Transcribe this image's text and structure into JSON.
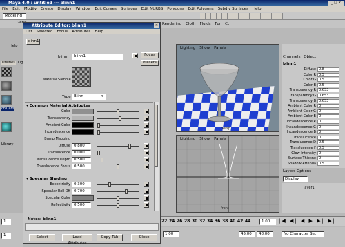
{
  "main_window": {
    "title": "Maya 4.0 : untitled  ---  blinn1",
    "menu": [
      "File",
      "Edit",
      "Modify",
      "Create",
      "Display",
      "Window",
      "Edit Curves",
      "Surfaces",
      "Edit NURBS",
      "Polygons",
      "Edit Polygons",
      "Subdiv Surfaces",
      "Help"
    ],
    "mode_dropdown": "Modeling",
    "shelf_tab": "Gene",
    "panel_menus": [
      "Rendering",
      "Cloth",
      "Fluids",
      "Fur",
      "Custom"
    ],
    "left_panel_labels": [
      "Help",
      "Utilities",
      "Lig",
      "Library"
    ],
    "node_label": "ch1lam"
  },
  "attribute_editor": {
    "title": "Attribute Editor: blinn1",
    "menu": [
      "List",
      "Selected",
      "Focus",
      "Attributes",
      "Help"
    ],
    "tab": "blinn1",
    "node_label": "blinn",
    "node_value": "blinn1",
    "focus_button": "Focus",
    "presets_button": "Presets",
    "sample_label": "Material Sample",
    "type_label": "Type",
    "type_value": "Blinn",
    "common_section": "Common Material Attributes",
    "common_rows": [
      {
        "label": "Color",
        "kind": "swatch",
        "value": "",
        "color": "#909090",
        "thumb": 0.5
      },
      {
        "label": "Transparency",
        "kind": "swatch",
        "value": "",
        "color": "#b4b4b4",
        "thumb": 0.55
      },
      {
        "label": "Ambient Color",
        "kind": "swatch",
        "value": "",
        "color": "#000000",
        "thumb": 0.02
      },
      {
        "label": "Incandescence",
        "kind": "swatch",
        "value": "",
        "color": "#000000",
        "thumb": 0.02
      },
      {
        "label": "Bump Mapping",
        "kind": "none",
        "value": "",
        "color": "",
        "thumb": 0
      },
      {
        "label": "Diffuse",
        "kind": "field",
        "value": "0.800",
        "color": "",
        "thumb": 0.8
      },
      {
        "label": "Translucence",
        "kind": "field",
        "value": "0.000",
        "color": "",
        "thumb": 0.02
      },
      {
        "label": "Translucence Depth",
        "kind": "field",
        "value": "0.500",
        "color": "",
        "thumb": 0.1
      },
      {
        "label": "Translucence Focus",
        "kind": "field",
        "value": "0.500",
        "color": "",
        "thumb": 0.5
      }
    ],
    "specular_section": "Specular Shading",
    "specular_rows": [
      {
        "label": "Eccentricity",
        "kind": "field",
        "value": "0.300",
        "color": "",
        "thumb": 0.3
      },
      {
        "label": "Specular Roll Off",
        "kind": "field",
        "value": "0.700",
        "color": "",
        "thumb": 0.7
      },
      {
        "label": "Specular Color",
        "kind": "swatch",
        "value": "",
        "color": "#808080",
        "thumb": 0.5
      },
      {
        "label": "Reflectivity",
        "kind": "field",
        "value": "0.500",
        "color": "",
        "thumb": 0.5
      }
    ],
    "notes_label": "Notes: blinn1",
    "buttons": [
      "Select",
      "Load Attributes",
      "Copy Tab",
      "Close"
    ]
  },
  "viewport_top": {
    "menus": [
      "Lighting",
      "Show",
      "Panels"
    ],
    "label": "persp"
  },
  "viewport_bottom": {
    "menus": [
      "Lighting",
      "Show",
      "Panels"
    ],
    "label": "front"
  },
  "channel_box": {
    "tabs": [
      "Channels",
      "Object"
    ],
    "node": "blinn1",
    "rows": [
      {
        "label": "Diffuse",
        "value": "0.8"
      },
      {
        "label": "Color R",
        "value": "0.5"
      },
      {
        "label": "Color G",
        "value": "0.5"
      },
      {
        "label": "Color B",
        "value": "0.5"
      },
      {
        "label": "Transparency R",
        "value": "0.653"
      },
      {
        "label": "Transparency G",
        "value": "0.653"
      },
      {
        "label": "Transparency B",
        "value": "0.653"
      },
      {
        "label": "Ambient Color R",
        "value": "0"
      },
      {
        "label": "Ambient Color G",
        "value": "0"
      },
      {
        "label": "Ambient Color B",
        "value": "0"
      },
      {
        "label": "Incandescence R",
        "value": "0"
      },
      {
        "label": "Incandescence G",
        "value": "0"
      },
      {
        "label": "Incandescence B",
        "value": "0"
      },
      {
        "label": "Translucence",
        "value": "0"
      },
      {
        "label": "Translucence D",
        "value": "0.5"
      },
      {
        "label": "Translucence F",
        "value": "0.5"
      },
      {
        "label": "Glow Intensity",
        "value": "0"
      },
      {
        "label": "Surface Thickne",
        "value": "0"
      },
      {
        "label": "Shadow Attenua",
        "value": "0.5"
      }
    ]
  },
  "layers": {
    "title": "Layers  Options",
    "display": "Display",
    "layer": "layer1"
  },
  "time_slider": {
    "ticks": [
      "22",
      "24",
      "26",
      "28",
      "30",
      "32",
      "34",
      "36",
      "38",
      "40",
      "42",
      "44"
    ],
    "current_frame": "1.00",
    "end_field_1": "1.00",
    "end_field_2": "45.00",
    "end_field_3": "48.00",
    "character_set": "No Character Set",
    "start_field": "1"
  }
}
